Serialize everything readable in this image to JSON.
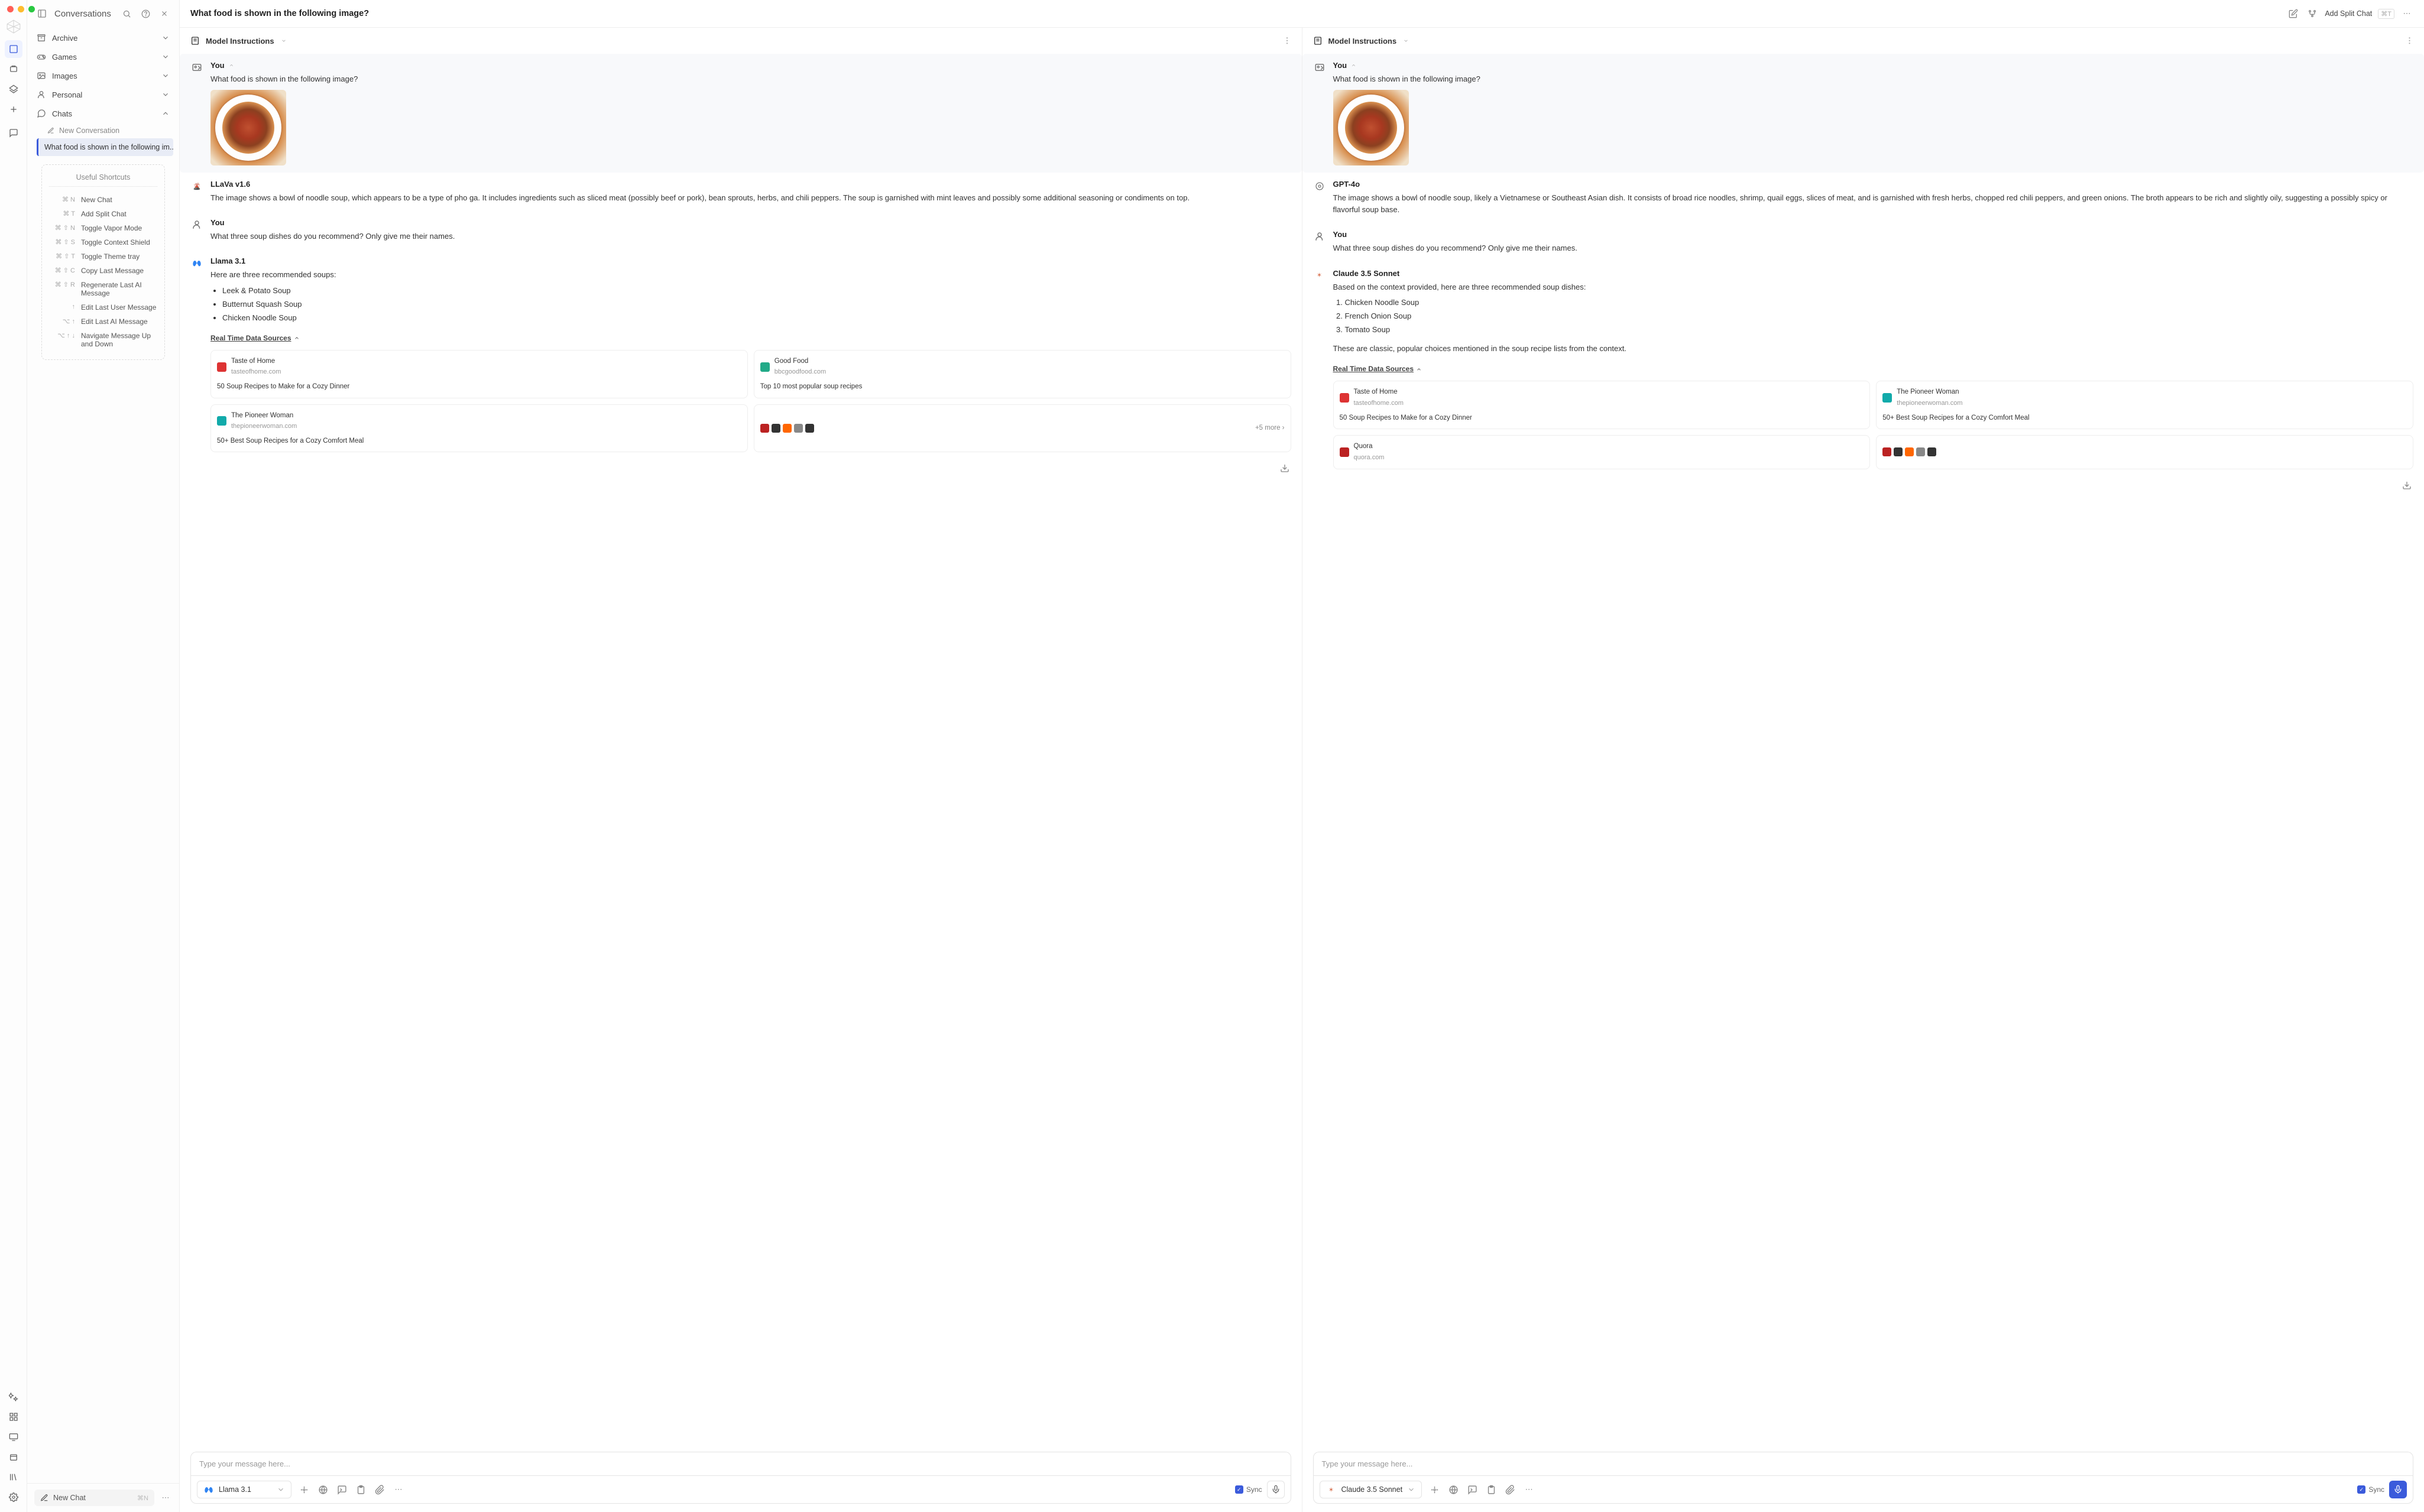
{
  "sidebar": {
    "title": "Conversations",
    "folders": [
      {
        "name": "Archive",
        "icon": "archive"
      },
      {
        "name": "Games",
        "icon": "games"
      },
      {
        "name": "Images",
        "icon": "images"
      },
      {
        "name": "Personal",
        "icon": "personal"
      },
      {
        "name": "Chats",
        "icon": "chats",
        "expanded": true
      }
    ],
    "new_conversation_label": "New Conversation",
    "active_conversation": "What food is shown in the following im..."
  },
  "shortcuts": {
    "title": "Useful Shortcuts",
    "rows": [
      {
        "key": "⌘ N",
        "label": "New Chat"
      },
      {
        "key": "⌘ T",
        "label": "Add Split Chat"
      },
      {
        "key": "⌘ ⇧ N",
        "label": "Toggle Vapor Mode"
      },
      {
        "key": "⌘ ⇧ S",
        "label": "Toggle Context Shield"
      },
      {
        "key": "⌘ ⇧ T",
        "label": "Toggle Theme tray"
      },
      {
        "key": "⌘ ⇧ C",
        "label": "Copy Last Message"
      },
      {
        "key": "⌘ ⇧ R",
        "label": "Regenerate Last AI Message"
      },
      {
        "key": "↑",
        "label": "Edit Last User Message"
      },
      {
        "key": "⌥ ↑",
        "label": "Edit Last AI Message"
      },
      {
        "key": "⌥ ↑ ↓",
        "label": "Navigate Message Up and Down"
      }
    ]
  },
  "new_chat": {
    "label": "New Chat",
    "kbd": "⌘N"
  },
  "header": {
    "title": "What food is shown in the following image?",
    "add_split_label": "Add Split Chat",
    "add_split_kbd": "⌘T"
  },
  "model_instructions_label": "Model Instructions",
  "panes": {
    "left": {
      "messages": [
        {
          "role": "you",
          "author": "You",
          "text": "What food is shown in the following image?",
          "has_image": true
        },
        {
          "role": "ai",
          "author": "LLaVa v1.6",
          "logo": "llava",
          "text": "The image shows a bowl of noodle soup, which appears to be a type of pho ga. It includes ingredients such as sliced meat (possibly beef or pork), bean sprouts, herbs, and chili peppers. The soup is garnished with mint leaves and possibly some additional seasoning or condiments on top."
        },
        {
          "role": "you",
          "author": "You",
          "text": "What three soup dishes do you recommend? Only give me their names."
        },
        {
          "role": "ai",
          "author": "Llama 3.1",
          "logo": "meta",
          "text": "Here are three recommended soups:",
          "list_type": "ul",
          "list": [
            "Leek & Potato Soup",
            "Butternut Squash Soup",
            "Chicken Noodle Soup"
          ],
          "sources_title": "Real Time Data Sources",
          "sources": [
            {
              "name": "Taste of Home",
              "domain": "tasteofhome.com",
              "title": "50 Soup Recipes to Make for a Cozy Dinner",
              "color": "#d33"
            },
            {
              "name": "Good Food",
              "domain": "bbcgoodfood.com",
              "title": "Top 10 most popular soup recipes",
              "color": "#2a8"
            },
            {
              "name": "The Pioneer Woman",
              "domain": "thepioneerwoman.com",
              "title": "50+ Best Soup Recipes for a Cozy Comfort Meal",
              "color": "#1aa"
            }
          ],
          "more_label": "+5 more"
        }
      ],
      "composer": {
        "placeholder": "Type your message here...",
        "model": "Llama 3.1",
        "model_logo": "meta",
        "sync_label": "Sync",
        "mic_recording": false
      }
    },
    "right": {
      "messages": [
        {
          "role": "you",
          "author": "You",
          "text": "What food is shown in the following image?",
          "has_image": true
        },
        {
          "role": "ai",
          "author": "GPT-4o",
          "logo": "openai",
          "text": "The image shows a bowl of noodle soup, likely a Vietnamese or Southeast Asian dish. It consists of broad rice noodles, shrimp, quail eggs, slices of meat, and is garnished with fresh herbs, chopped red chili peppers, and green onions. The broth appears to be rich and slightly oily, suggesting a possibly spicy or flavorful soup base."
        },
        {
          "role": "you",
          "author": "You",
          "text": "What three soup dishes do you recommend? Only give me their names."
        },
        {
          "role": "ai",
          "author": "Claude 3.5 Sonnet",
          "logo": "anthropic",
          "text": "Based on the context provided, here are three recommended soup dishes:",
          "list_type": "ol",
          "list": [
            "Chicken Noodle Soup",
            "French Onion Soup",
            "Tomato Soup"
          ],
          "after_text": "These are classic, popular choices mentioned in the soup recipe lists from the context.",
          "sources_title": "Real Time Data Sources",
          "sources": [
            {
              "name": "Taste of Home",
              "domain": "tasteofhome.com",
              "title": "50 Soup Recipes to Make for a Cozy Dinner",
              "color": "#d33"
            },
            {
              "name": "The Pioneer Woman",
              "domain": "thepioneerwoman.com",
              "title": "50+ Best Soup Recipes for a Cozy Comfort Meal",
              "color": "#1aa"
            },
            {
              "name": "Quora",
              "domain": "quora.com",
              "title": "",
              "color": "#b22"
            }
          ]
        }
      ],
      "composer": {
        "placeholder": "Type your message here...",
        "model": "Claude 3.5 Sonnet",
        "model_logo": "anthropic",
        "sync_label": "Sync",
        "mic_recording": true
      }
    }
  }
}
